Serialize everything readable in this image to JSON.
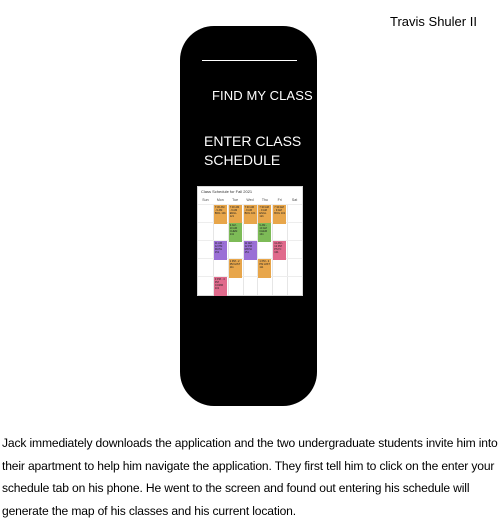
{
  "author": "Travis Shuler II",
  "phone": {
    "find_class_label": "FIND MY CLASS",
    "enter_schedule_label": "ENTER CLASS SCHEDULE"
  },
  "schedule": {
    "title": "Class Schedule for Fall 2021",
    "days": [
      "Sun",
      "Mon",
      "Tue",
      "Wed",
      "Thu",
      "Fri",
      "Sat"
    ],
    "classes": [
      {
        "day": 1,
        "row": 0,
        "text": "7:30 AM - 9 AM BIOL 101",
        "color": "#e8a64a"
      },
      {
        "day": 2,
        "row": 0,
        "text": "7:30 AM - 9 AM ENGL 121",
        "color": "#e8a64a"
      },
      {
        "day": 3,
        "row": 0,
        "text": "7:30 AM - 9 AM BIOL 101",
        "color": "#e8a64a"
      },
      {
        "day": 4,
        "row": 0,
        "text": "7:30 AM - 9 AM ENGL 121",
        "color": "#e8a64a"
      },
      {
        "day": 5,
        "row": 0,
        "text": "7:30 AM - 9 AM BIOL 101",
        "color": "#e8a64a"
      },
      {
        "day": 2,
        "row": 1,
        "text": "9 AM - 10 AM CHEM 141",
        "color": "#7dbb57"
      },
      {
        "day": 4,
        "row": 1,
        "text": "9 AM - 10 AM CHEM 141",
        "color": "#7dbb57"
      },
      {
        "day": 1,
        "row": 2,
        "text": "11 AM - 12 PM MATH 151",
        "color": "#9a6fd6"
      },
      {
        "day": 3,
        "row": 2,
        "text": "11 AM - 12 PM MATH 151",
        "color": "#9a6fd6"
      },
      {
        "day": 5,
        "row": 2,
        "text": "11 AM - 12 PM PSYC 101",
        "color": "#e06a8c"
      },
      {
        "day": 2,
        "row": 3,
        "text": "1 PM - 2 PM HIST 111",
        "color": "#e8a64a"
      },
      {
        "day": 4,
        "row": 3,
        "text": "1 PM - 2 PM HIST 111",
        "color": "#e8a64a"
      },
      {
        "day": 1,
        "row": 4,
        "text": "3 PM - 4 PM COMM 101",
        "color": "#e06a8c"
      }
    ]
  },
  "caption": "Jack immediately downloads the application and the two undergraduate students invite him into their apartment to help him navigate the application. They first tell him to click on the enter your schedule tab on his phone. He went to the screen and found out entering his schedule will generate the map of his classes and his current location."
}
